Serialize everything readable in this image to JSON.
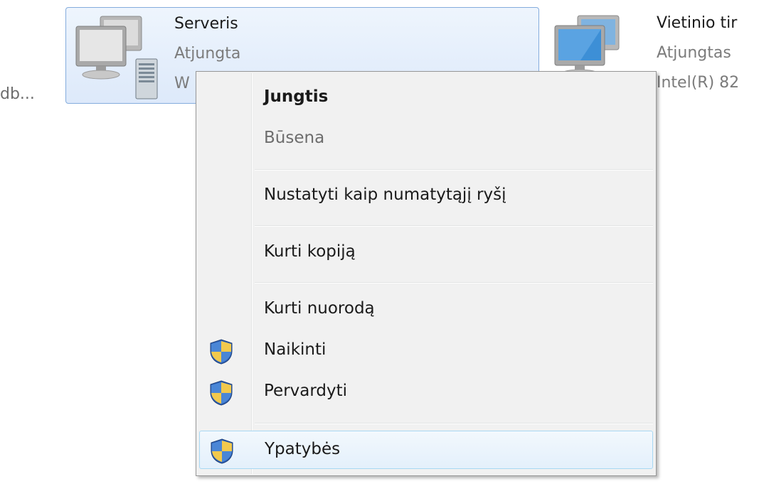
{
  "background_text": {
    "left_truncated": "db..."
  },
  "tiles": [
    {
      "name": "Serveris",
      "status": "Atjungta",
      "device": "W",
      "icon": "server-computer-icon",
      "selected": true
    },
    {
      "name": "Vietinio tir",
      "status": "Atjungtas",
      "device": "Intel(R) 82",
      "icon": "lan-computer-icon",
      "selected": false
    }
  ],
  "context_menu": {
    "items": [
      {
        "label": "Jungtis",
        "bold": true,
        "disabled": false,
        "shield": false
      },
      {
        "label": "Būsena",
        "bold": false,
        "disabled": true,
        "shield": false
      },
      {
        "label": "Nustatyti kaip numatytąjį ryšį",
        "bold": false,
        "disabled": false,
        "shield": false
      },
      {
        "label": "Kurti kopiją",
        "bold": false,
        "disabled": false,
        "shield": false
      },
      {
        "label": "Kurti nuorodą",
        "bold": false,
        "disabled": false,
        "shield": false
      },
      {
        "label": "Naikinti",
        "bold": false,
        "disabled": false,
        "shield": true
      },
      {
        "label": "Pervardyti",
        "bold": false,
        "disabled": false,
        "shield": true
      },
      {
        "label": "Ypatybės",
        "bold": false,
        "disabled": false,
        "shield": true,
        "hovered": true
      }
    ]
  },
  "colors": {
    "selection_border": "#84acdd",
    "menu_background": "#f1f1f1",
    "hover_border": "#a8d8f3"
  }
}
